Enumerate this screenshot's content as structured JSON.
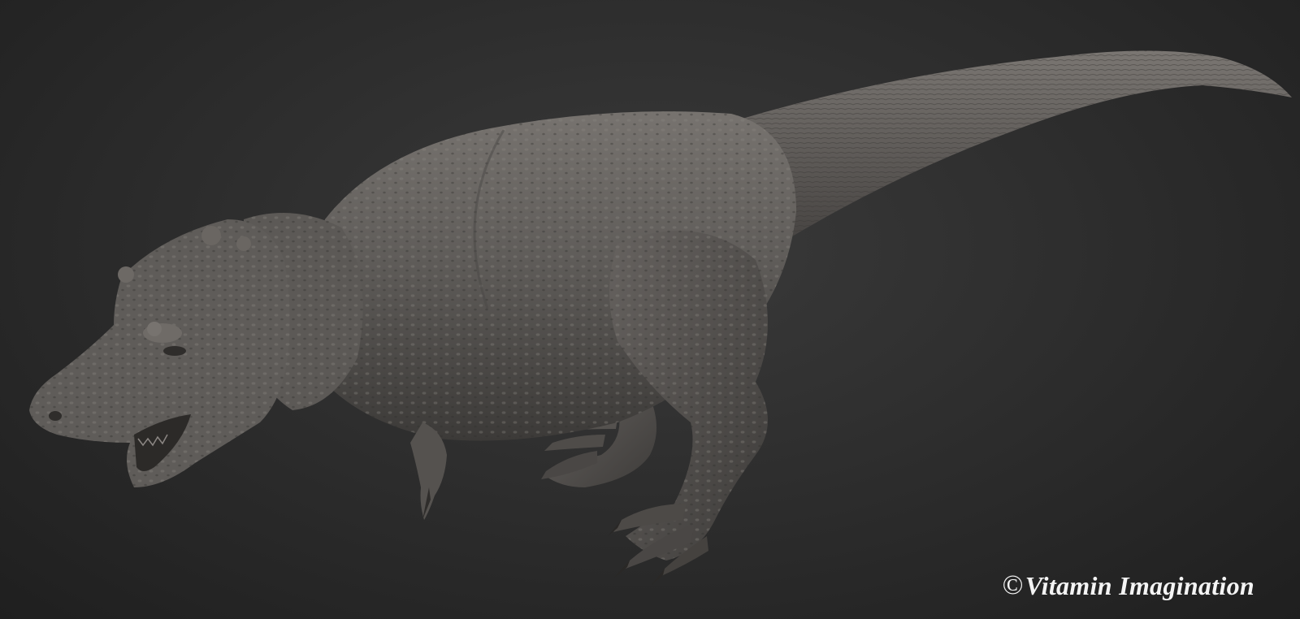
{
  "image": {
    "subject": "3D sculpt render",
    "background_color": "#2e2e2e",
    "model_color": "#5e5b58"
  },
  "watermark": {
    "symbol": "©",
    "text": "Vitamin Imagination"
  }
}
